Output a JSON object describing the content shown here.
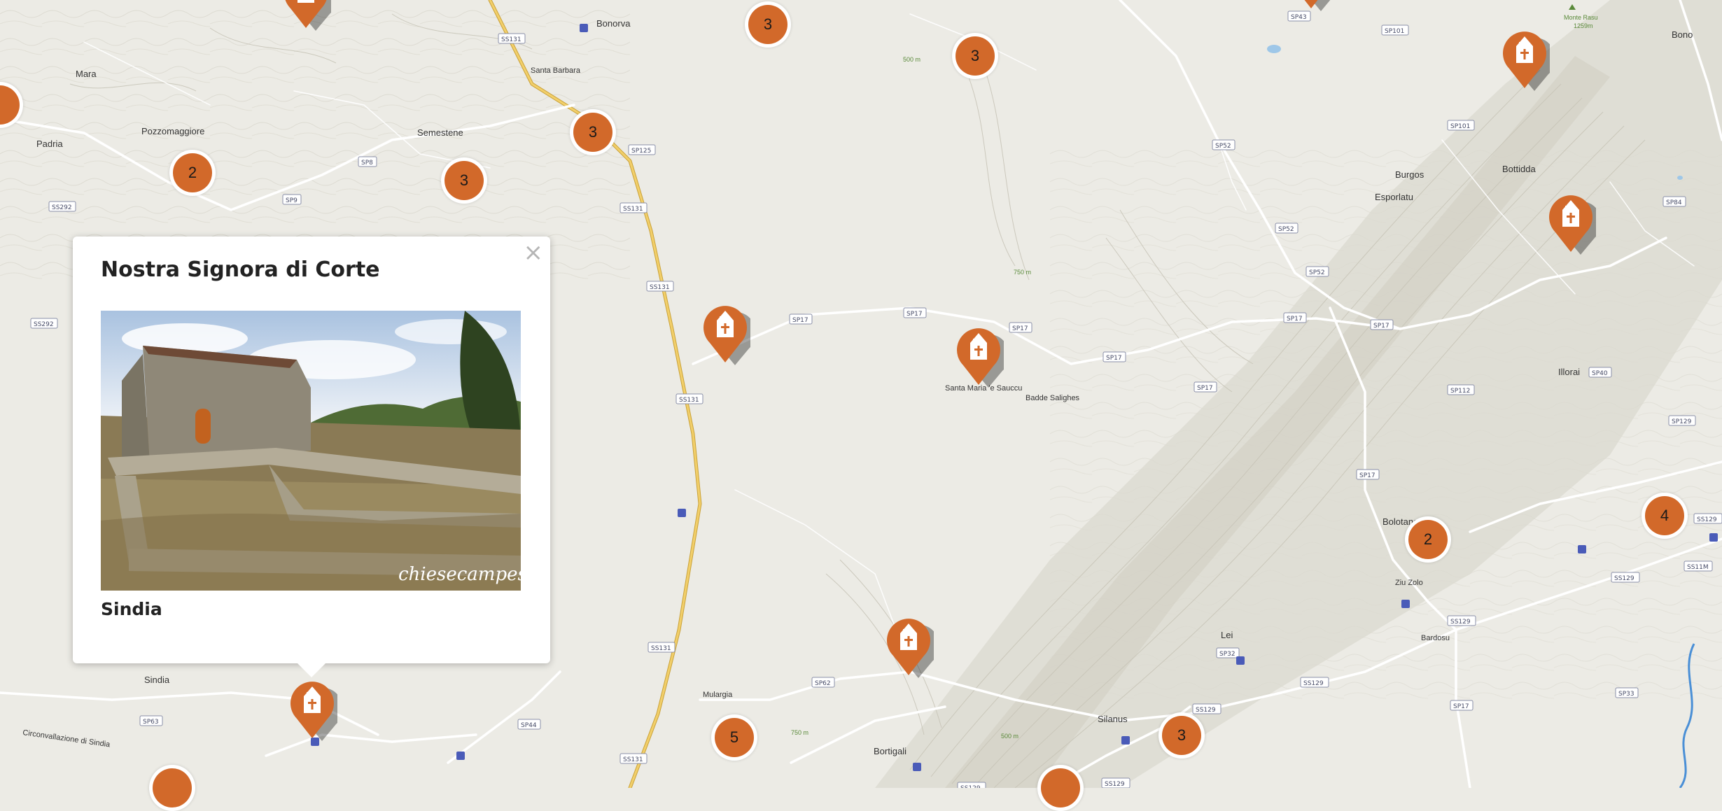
{
  "map": {
    "places": [
      {
        "name": "Bonorva"
      },
      {
        "name": "Mara"
      },
      {
        "name": "Padria"
      },
      {
        "name": "Pozzomaggiore"
      },
      {
        "name": "Semestene"
      },
      {
        "name": "Santa Barbara"
      },
      {
        "name": "Santa Maria 'e Sauccu"
      },
      {
        "name": "Badde Salighes"
      },
      {
        "name": "Burgos"
      },
      {
        "name": "Bottidda"
      },
      {
        "name": "Esporlatu"
      },
      {
        "name": "Illorai"
      },
      {
        "name": "Bono"
      },
      {
        "name": "Monte Rasu"
      },
      {
        "name": "1259m"
      },
      {
        "name": "Bolotana"
      },
      {
        "name": "Ziu Zolo"
      },
      {
        "name": "Bardosu"
      },
      {
        "name": "Lei"
      },
      {
        "name": "Silanus"
      },
      {
        "name": "Bortigali"
      },
      {
        "name": "Mulargia"
      },
      {
        "name": "Sindia"
      },
      {
        "name": "Circonvallazione di Sindia"
      }
    ],
    "roads": [
      "SS131",
      "SP125",
      "SP8",
      "SP9",
      "SS292",
      "SP17",
      "SP52",
      "SP101",
      "SP43",
      "SP112",
      "SP40",
      "SP84",
      "SS129",
      "SS129",
      "SP32",
      "SP62",
      "SP63",
      "SP44",
      "SP33",
      "SS11M",
      "SP129"
    ],
    "contours": [
      "500 m",
      "750 m"
    ],
    "clusters": [
      {
        "count": "3"
      },
      {
        "count": "3"
      },
      {
        "count": "3"
      },
      {
        "count": "2"
      },
      {
        "count": "3"
      },
      {
        "count": "2"
      },
      {
        "count": "4"
      },
      {
        "count": "5"
      },
      {
        "count": "3"
      }
    ],
    "marker_icon": "church-icon",
    "colors": {
      "marker": "#d2692a",
      "background": "#ecebe5",
      "road": "#ffffff",
      "highway": "#f0c050"
    }
  },
  "popup": {
    "title": "Nostra Signora di Corte",
    "subtitle": "Sindia",
    "close_label": "×",
    "watermark": "chiesecampestri.it"
  }
}
